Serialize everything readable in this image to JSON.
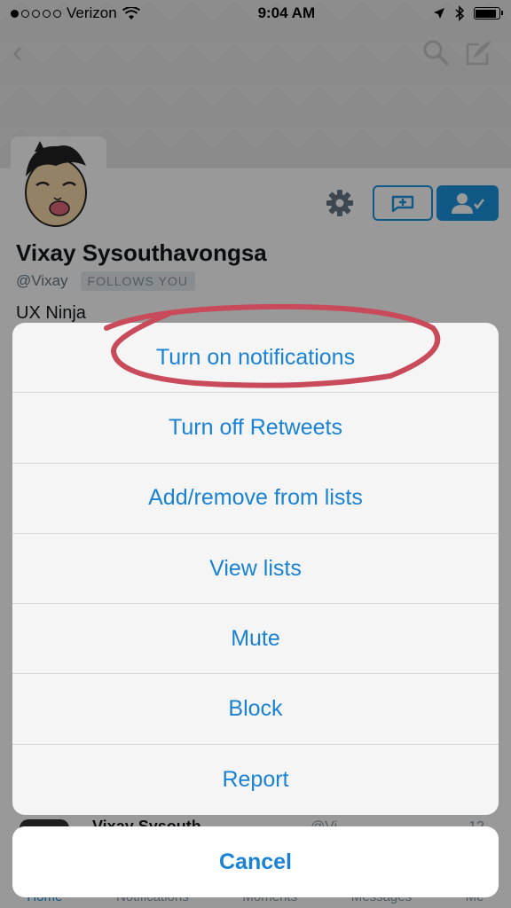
{
  "status_bar": {
    "carrier": "Verizon",
    "time": "9:04 AM",
    "signal_bars_filled": 1,
    "signal_bars_total": 5,
    "battery_level": 0.9
  },
  "profile": {
    "name": "Vixay Sysouthavongsa",
    "handle": "@Vixay",
    "follows_you_badge": "FOLLOWS YOU",
    "bio": "UX Ninja"
  },
  "tweet_preview": {
    "name": "Vixay Sysouth",
    "meta": "@Vi",
    "time": "12"
  },
  "tab_bar": {
    "tabs": [
      {
        "label": "Home",
        "active": true
      },
      {
        "label": "Notifications",
        "active": false
      },
      {
        "label": "Moments",
        "active": false
      },
      {
        "label": "Messages",
        "active": false
      },
      {
        "label": "Me",
        "active": false
      }
    ]
  },
  "action_sheet": {
    "items": [
      "Turn on notifications",
      "Turn off Retweets",
      "Add/remove from lists",
      "View lists",
      "Mute",
      "Block",
      "Report"
    ],
    "cancel_label": "Cancel"
  },
  "colors": {
    "accent": "#1a82d4",
    "twitter_blue": "#1b95e0",
    "annotation": "#c94a5a"
  },
  "icons": [
    "back-icon",
    "search-icon",
    "compose-icon",
    "gear-icon",
    "direct-message-icon",
    "following-icon",
    "wifi-icon",
    "location-icon",
    "bluetooth-icon",
    "battery-icon"
  ]
}
